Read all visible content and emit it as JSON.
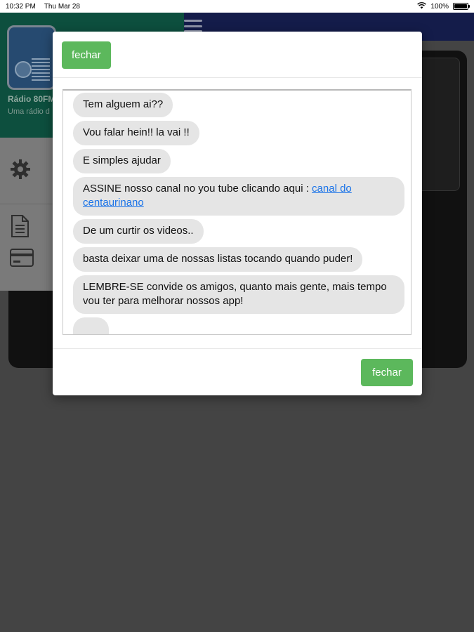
{
  "status_bar": {
    "time": "10:32 PM",
    "date": "Thu Mar 28",
    "battery_percent": "100%",
    "battery_level": 1.0
  },
  "drawer": {
    "title": "Rádio 80FM",
    "subtitle": "Uma rádio d",
    "settings_icon": "gear-icon",
    "document_icon": "document-icon",
    "card_icon": "credit-card-icon"
  },
  "modal": {
    "header_button": "fechar",
    "footer_button": "fechar",
    "button_color": "#5cb85c",
    "messages": [
      {
        "text": "Tem alguem ai??"
      },
      {
        "text": "Vou falar hein!! la vai !!"
      },
      {
        "text": "E simples ajudar"
      },
      {
        "text": "ASSINE nosso canal no you tube clicando aqui : ",
        "link": "canal do centaurinano"
      },
      {
        "text": "De um curtir os videos.."
      },
      {
        "text": "basta deixar uma de nossas listas tocando quando puder!"
      },
      {
        "text": "LEMBRE-SE convide os amigos, quanto mais gente, mais tempo vou ter para melhorar nossos app!"
      }
    ],
    "typing_indicator": "..."
  },
  "colors": {
    "overlay": "#444444",
    "top_bar": "#141c4a",
    "drawer_header": "#0d4f3e",
    "link": "#1a73e8",
    "bubble": "#e5e5e5"
  }
}
